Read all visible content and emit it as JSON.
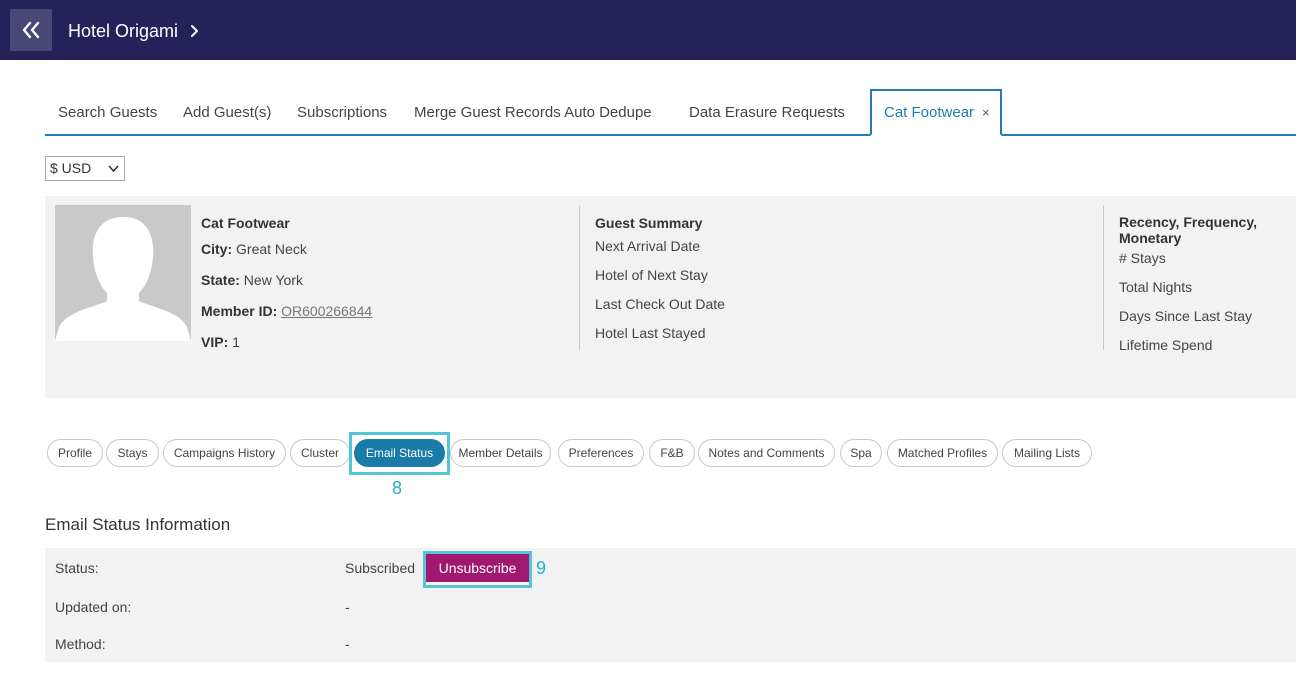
{
  "header": {
    "title": "Hotel Origami",
    "back_icon": "double-chevron-left-icon",
    "chevron_icon": "chevron-right-icon",
    "bg_color": "#25225a"
  },
  "tabs": [
    {
      "label": "Search Guests"
    },
    {
      "label": "Add Guest(s)"
    },
    {
      "label": "Subscriptions"
    },
    {
      "label": "Merge Guest Records Auto Dedupe"
    },
    {
      "label": "Data Erasure Requests"
    },
    {
      "label": "Cat Footwear",
      "active": true,
      "close": "×"
    }
  ],
  "currency": {
    "selected": "$ USD"
  },
  "guest": {
    "name": "Cat Footwear",
    "city_label": "City:",
    "city": "Great Neck",
    "state_label": "State:",
    "state": "New York",
    "member_label": "Member ID:",
    "member_id": "OR600266844",
    "vip_label": "VIP:",
    "vip": "1"
  },
  "summary": {
    "heading": "Guest Summary",
    "rows": [
      "Next Arrival Date",
      "Hotel of Next Stay",
      "Last Check Out Date",
      "Hotel Last Stayed"
    ]
  },
  "rfm": {
    "heading": "Recency, Frequency, Monetary",
    "rows": [
      "# Stays",
      "Total Nights",
      "Days Since Last Stay",
      "Lifetime Spend"
    ]
  },
  "subtabs": [
    {
      "label": "Profile"
    },
    {
      "label": "Stays"
    },
    {
      "label": "Campaigns History"
    },
    {
      "label": "Cluster"
    },
    {
      "label": "Email Status",
      "active": true
    },
    {
      "label": "Member Details"
    },
    {
      "label": "Preferences"
    },
    {
      "label": "F&B"
    },
    {
      "label": "Notes and Comments"
    },
    {
      "label": "Spa"
    },
    {
      "label": "Matched Profiles"
    },
    {
      "label": "Mailing Lists"
    }
  ],
  "callouts": {
    "email_status": "8",
    "unsubscribe": "9"
  },
  "email_status": {
    "title": "Email Status Information",
    "status_label": "Status:",
    "status_value": "Subscribed",
    "unsubscribe_label": "Unsubscribe",
    "updated_label": "Updated on:",
    "updated_value": "-",
    "method_label": "Method:",
    "method_value": "-"
  },
  "colors": {
    "accent": "#1f7db0",
    "unsubscribe": "#a0186f",
    "highlight": "#54c4d6"
  }
}
